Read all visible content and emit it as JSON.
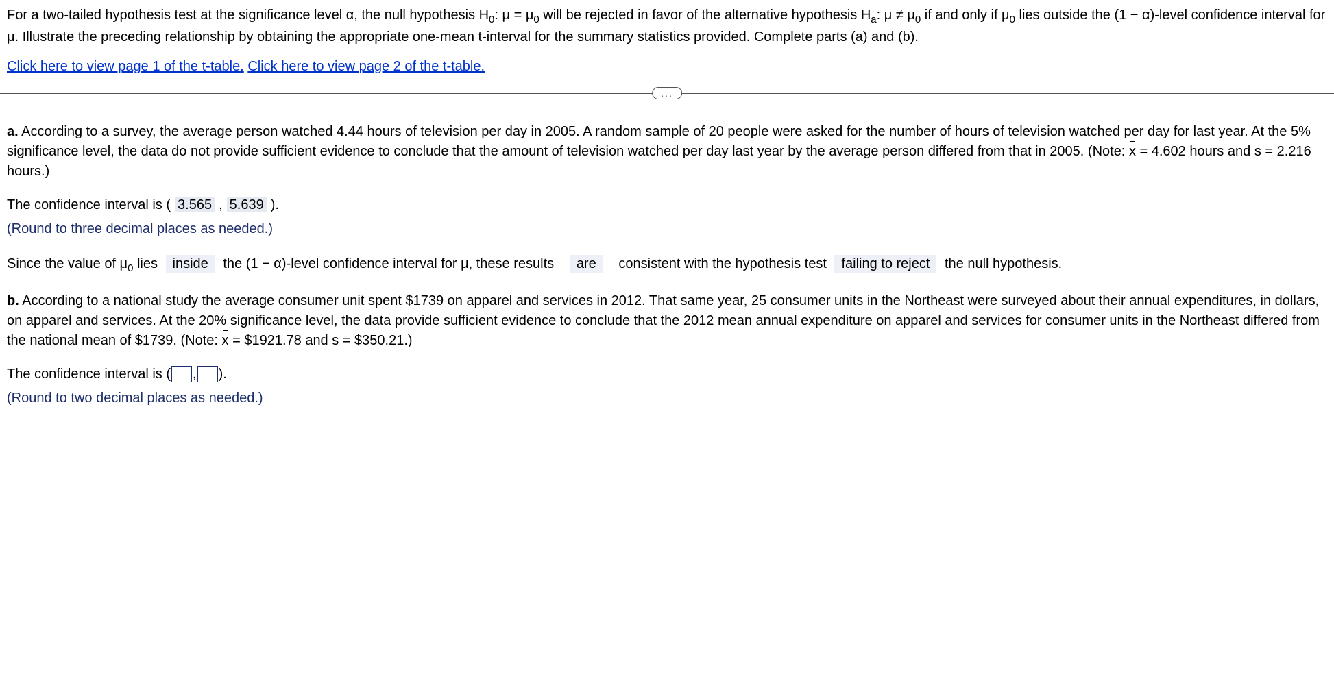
{
  "intro": {
    "t1": "For a two-tailed hypothesis test at the significance level α, the null hypothesis H",
    "sub0a": "0",
    "t2": ": μ = μ",
    "sub0b": "0",
    "t3": " will be rejected in favor of the alternative hypothesis H",
    "suba": "a",
    "t4": ": μ ≠ μ",
    "sub0c": "0",
    "t5": " if and only if μ",
    "sub0d": "0",
    "t6": " lies outside the (1 − α)-level confidence interval for μ. Illustrate the preceding relationship by obtaining the appropriate one-mean t-interval for the summary statistics provided. Complete parts (a) and (b)."
  },
  "links": {
    "page1": "Click here to view page 1 of the t-table.",
    "page2": "Click here to view page 2 of the t-table."
  },
  "divider": "...",
  "partA": {
    "label": "a.",
    "body1": " According to a survey, the average person watched 4.44 hours of television per day in 2005. A random sample of 20 people were asked for the number of hours of television watched per day for last year. At the 5% significance level, the data do not provide sufficient evidence to conclude that the amount of television watched per day last year by the average person differed from that in 2005. (Note: ",
    "xbar": "x",
    "stats": " = 4.602 hours and s = 2.216 hours.)",
    "ci_pre": "The confidence interval is (",
    "ci_lo": "3.565",
    "ci_mid": ",",
    "ci_hi": "5.639",
    "ci_post": ").",
    "round": "(Round to three decimal places as needed.)",
    "s1": "Since the value of μ",
    "s1sub": "0",
    "s2": " lies ",
    "dd1": "inside",
    "s3": " the (1 − α)-level confidence interval for μ, these results ",
    "dd2": "are",
    "s4": " consistent with the hypothesis test ",
    "dd3": "failing to reject",
    "s5": " the null hypothesis."
  },
  "partB": {
    "label": "b.",
    "body1": " According to a national study the average consumer unit spent $1739 on apparel and services in 2012. That same year, 25 consumer units in the Northeast were surveyed about their annual expenditures, in dollars, on apparel and services. At the 20% significance level, the data provide sufficient evidence to conclude that the 2012 mean annual expenditure on apparel and services for consumer units in the Northeast differed from the national mean of $1739. (Note: ",
    "xbar": "x",
    "stats": " = $1921.78 and s = $350.21.)",
    "ci_pre": "The confidence interval is (",
    "ci_mid": ",",
    "ci_post": ").",
    "round": "(Round to two decimal places as needed.)"
  }
}
